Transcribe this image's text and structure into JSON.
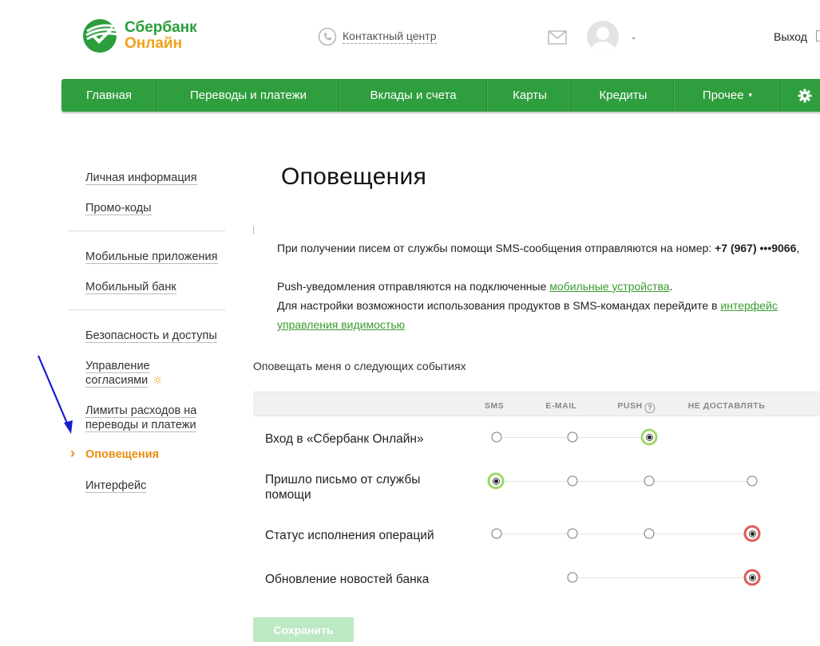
{
  "brand": {
    "line1": "Сбербанк",
    "line2": "Онлайн",
    "green": "#2b9e3b",
    "orange": "#f0a21b"
  },
  "header": {
    "contact_label": "Контактный центр",
    "logout_label": "Выход",
    "icons": [
      "phone-icon",
      "mail-icon",
      "avatar",
      "logout-icon"
    ]
  },
  "nav": {
    "color": "#2f9e3e",
    "items": [
      {
        "label": "Главная"
      },
      {
        "label": "Переводы и платежи"
      },
      {
        "label": "Вклады и счета"
      },
      {
        "label": "Карты"
      },
      {
        "label": "Кредиты"
      },
      {
        "label": "Прочее"
      }
    ],
    "settings_icon": "gear-icon"
  },
  "sidebar": {
    "groups": [
      [
        "Личная информация",
        "Промо-коды"
      ],
      [
        "Мобильные приложения",
        "Мобильный банк"
      ],
      [
        "Безопасность и доступы",
        "Управление согласиями",
        "Лимиты расходов на переводы и платежи",
        "Оповещения",
        "Интерфейс"
      ]
    ],
    "items": {
      "personal_info": "Личная информация",
      "promo_codes": "Промо-коды",
      "mobile_apps": "Мобильные приложения",
      "mobile_bank": "Мобильный банк",
      "security": "Безопасность и доступы",
      "consents_1": "Управление",
      "consents_2": "согласиями",
      "limits_1": "Лимиты расходов на",
      "limits_2": "переводы и платежи",
      "notifications": "Оповещения",
      "interface": "Интерфейс"
    },
    "active": "Оповещения",
    "active_color": "#ee8c14"
  },
  "main": {
    "title": "Оповещения",
    "info": {
      "sms_text": "При получении писем от службы помощи SMS-сообщения отправляются на номер: ",
      "phone": "+7 (967) •••9066",
      "phone_tail": ",",
      "push_text": "Push-уведомления отправляются на подключенные ",
      "push_link": "мобильные устройства",
      "push_tail": ".",
      "visibility_text": "Для настройки возможности использования продуктов в SMS-командах перейдите в ",
      "visibility_link_1": "интерфейс",
      "visibility_link_2": "управления видимостью"
    },
    "events_title": "Оповещать меня о следующих событиях",
    "columns": [
      "SMS",
      "E-MAIL",
      "PUSH",
      "НЕ ДОСТАВЛЯТЬ"
    ],
    "push_help_icon": "help-icon",
    "rows": [
      {
        "label": "Вход в «Сбербанк Онлайн»",
        "options": [
          "SMS",
          "E-MAIL",
          "PUSH"
        ],
        "selected": "PUSH"
      },
      {
        "label_1": "Пришло письмо от службы",
        "label_2": "помощи",
        "options": [
          "SMS",
          "E-MAIL",
          "PUSH",
          "НЕ ДОСТАВЛЯТЬ"
        ],
        "selected": "SMS"
      },
      {
        "label": "Статус исполнения операций",
        "options": [
          "SMS",
          "E-MAIL",
          "PUSH",
          "НЕ ДОСТАВЛЯТЬ"
        ],
        "selected": "НЕ ДОСТАВЛЯТЬ"
      },
      {
        "label": "Обновление новостей банка",
        "options": [
          "E-MAIL",
          "НЕ ДОСТАВЛЯТЬ"
        ],
        "selected": "НЕ ДОСТАВЛЯТЬ"
      }
    ],
    "save_label": "Сохранить",
    "selected_colors": {
      "on": "#9fd86b",
      "off": "#e05a5a"
    }
  }
}
